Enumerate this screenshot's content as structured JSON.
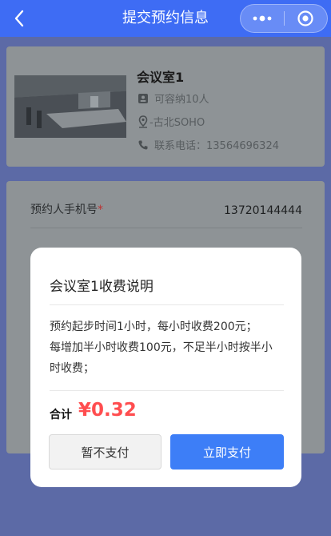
{
  "navbar": {
    "title": "提交预约信息"
  },
  "room": {
    "name": "会议室1",
    "capacity": "可容纳10人",
    "location": "-古北SOHO",
    "phone": "联系电话：13564696324"
  },
  "form": {
    "phone_label": "预约人手机号",
    "required_mark": "*",
    "phone_value": "13720144444"
  },
  "modal": {
    "title": "会议室1收费说明",
    "desc_lines": [
      "预约起步时间1小时，每小时收费200元；",
      "每增加半小时收费100元，不足半小时按半小",
      "时收费；"
    ],
    "total_label": "合计",
    "total_amount": "¥0.32",
    "cancel_label": "暂不支付",
    "pay_label": "立即支付"
  },
  "colors": {
    "nav": "#3e6cf4",
    "price": "#ff4d4f",
    "primary_button": "#3d7ef7"
  }
}
